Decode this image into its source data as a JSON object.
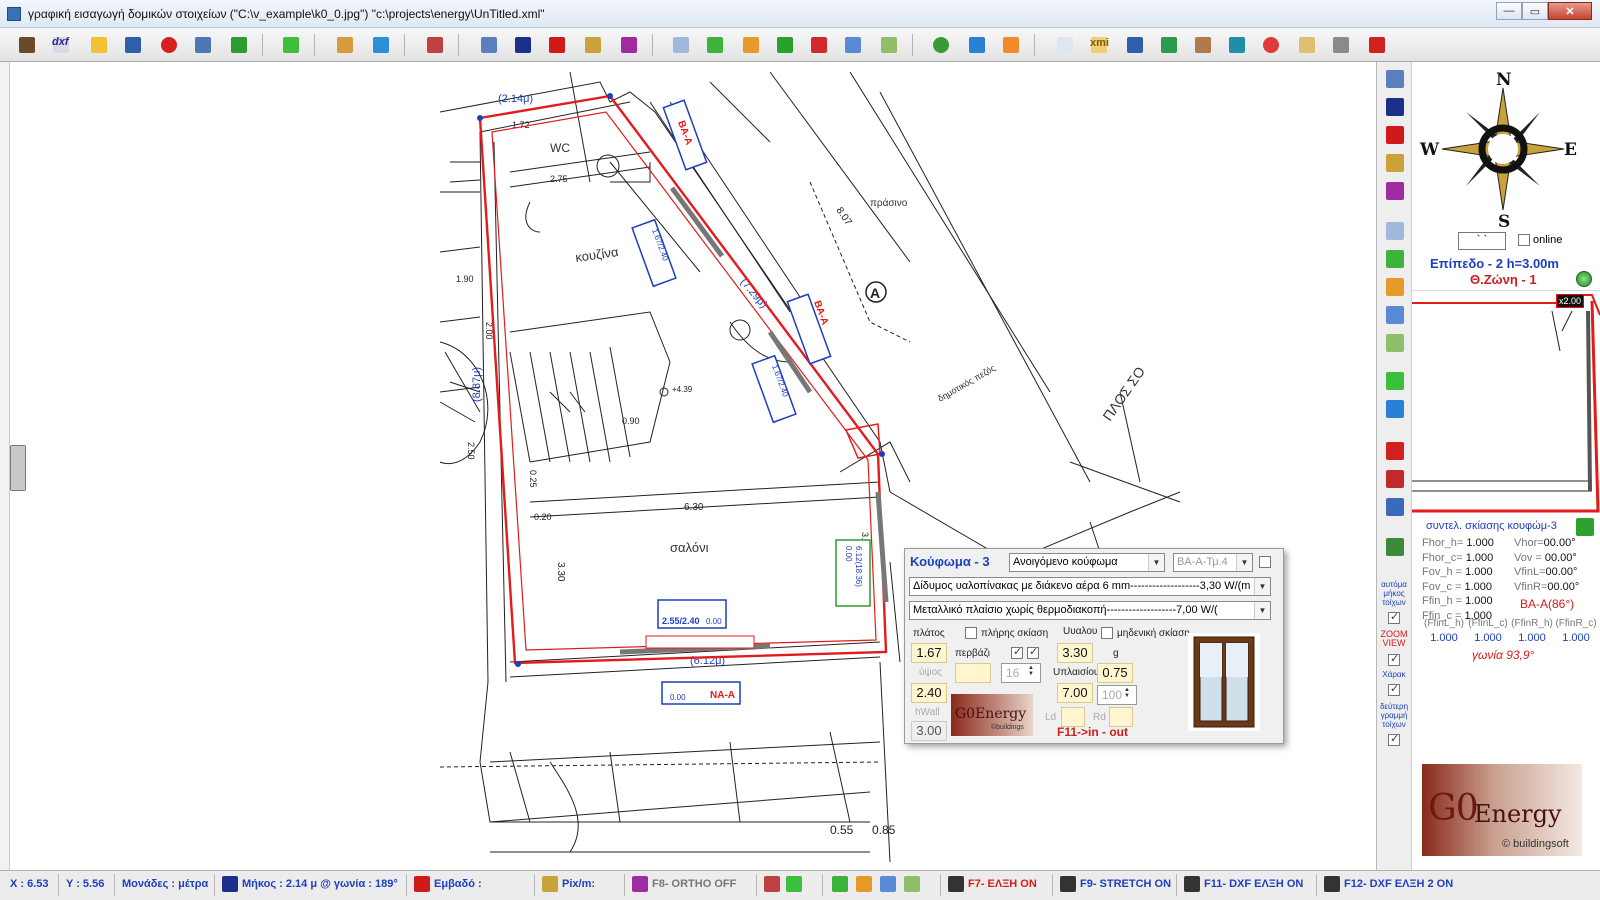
{
  "window": {
    "title": "γραφική εισαγωγή δομικών στοιχείων (\"C:\\v_example\\k0_0.jpg\") \"c:\\projects\\energy\\UnTitled.xml\"",
    "min_icon": "minimize-icon",
    "max_icon": "maximize-icon",
    "close_icon": "close-icon",
    "min_glyph": "—",
    "max_glyph": "▭",
    "close_glyph": "✕"
  },
  "toolbar": {
    "dxf_label": "dxf",
    "xmi_label": "xmi"
  },
  "plan": {
    "rooms": [
      "WC",
      "κουζίνα",
      "σαλόνι",
      "πράσινο"
    ],
    "dims": [
      "(2.14μ)",
      "(7.29μ)",
      "(8.87μ)",
      "(6.12μ)",
      "6.30",
      "8.07",
      "3.30",
      "2.50",
      "2.75",
      "0.55",
      "0.85",
      "3.96",
      "1.90",
      "2.00",
      "1.72",
      "0.20",
      "0.25",
      "0.90",
      "+4.39"
    ],
    "marker": "A",
    "street": "ΠΛΟΣ ΣΟ",
    "sidewalk": "δημοτικός πεζός",
    "wall_tags": [
      "BA-A",
      "BA-A",
      "NA-A"
    ],
    "window_tags": [
      "1.67/2.40",
      "1.67/2.40",
      "2.55/2.40",
      "6.12(18.36)"
    ],
    "zero_tags": [
      "0.00",
      "0.00",
      "0.00"
    ]
  },
  "right_panel": {
    "compass": {
      "n": "N",
      "s": "S",
      "e": "E",
      "w": "W"
    },
    "online_value": "` `",
    "online_label": "online",
    "level_label": "Επίπεδο - 2  h=3.00m",
    "zone_label": "Θ.Ζώνη - 1",
    "minimap_badge": "x2.00",
    "shade_title": "συντελ. σκίασης κουφώμ-3",
    "shade_rows": [
      {
        "k1": "Fhor_h= ",
        "v1": "1.000",
        "k2": "Vhor=",
        "v2": "00.00°"
      },
      {
        "k1": "Fhor_c= ",
        "v1": "1.000",
        "k2": "Vov = ",
        "v2": "00.00°"
      },
      {
        "k1": "Fov_h = ",
        "v1": "1.000",
        "k2": "VfinL=",
        "v2": "00.00°"
      },
      {
        "k1": "Fov_c = ",
        "v1": "1.000",
        "k2": "VfinR=",
        "v2": "00.00°"
      },
      {
        "k1": "Ffin_h = ",
        "v1": "1.000",
        "k2": "",
        "v2": ""
      },
      {
        "k1": "Ffin_c = ",
        "v1": "1.000",
        "k2": "",
        "v2": ""
      }
    ],
    "ba_angle": "BA-A(86°)",
    "ffin_headers": [
      "(FfinL_h)",
      "(FfinL_c)",
      "(FfinR_h)",
      "(FfinR_c)"
    ],
    "ffin_values": [
      "1.000",
      "1.000",
      "1.000",
      "1.000"
    ],
    "angle_text": "γωνία 93,9°",
    "logo_big": "G0",
    "logo_word": "Energy",
    "logo_by": "© buildingsoft"
  },
  "vbar_labels": {
    "auto": "αυτόμα μήκος τοίχων",
    "zoom": "ZOOM VIEW",
    "xarak": "Χάρακ",
    "second": "δεύτερη γραμμή τοίχων"
  },
  "dialog": {
    "title": "Κούφωμα - 3",
    "type_select": "Ανοιγόμενο κούφωμα",
    "wall_select": "BA-A-Τμ.4",
    "glass_select": "Δίδυμος υαλοπίνακας με διάκενο αέρα 6 mm-------------------3,30 W/(m",
    "frame_select": "Μεταλλικό πλαίσιο χωρίς θερμοδιακοπή-------------------7,00 W/(",
    "width_label": "πλάτος",
    "width_value": "1.67",
    "full_shade_label": "πλήρης σκίαση",
    "perv_label": "περβάζι",
    "height_label": "ύψος",
    "height_value": "2.40",
    "spin_16": "16",
    "uglass_label": "Uυαλου",
    "uglass_value": "3.30",
    "g_label": "g",
    "g_value": "0.75",
    "uframe_label": "Uπλαισίου",
    "uframe_value": "7.00",
    "spin_100": "100",
    "zero_shade_label": "μηδενική σκίαση",
    "hwall_label": "hWall",
    "hwall_value": "3.00",
    "ld_label": "Ld",
    "rd_label": "Rd",
    "logo_text": "G0Energy",
    "logo_by": "©buildings",
    "f11_text": "F11->in - out"
  },
  "status": {
    "x": "X : 6.53",
    "y": "Y : 5.56",
    "units": "Μονάδες : μέτρα",
    "length": "Μήκος : 2.14 μ @ γωνία : 189°",
    "area": "Εμβαδό :",
    "pix": "Pix/m:",
    "f8": "F8- ORTHO OFF",
    "f7": "F7- ΕΛΞΗ ON",
    "f9": "F9- STRETCH ON",
    "f11": "F11- DXF ΕΛΞΗ ON",
    "f12": "F12- DXF ΕΛΞΗ 2 ON"
  }
}
